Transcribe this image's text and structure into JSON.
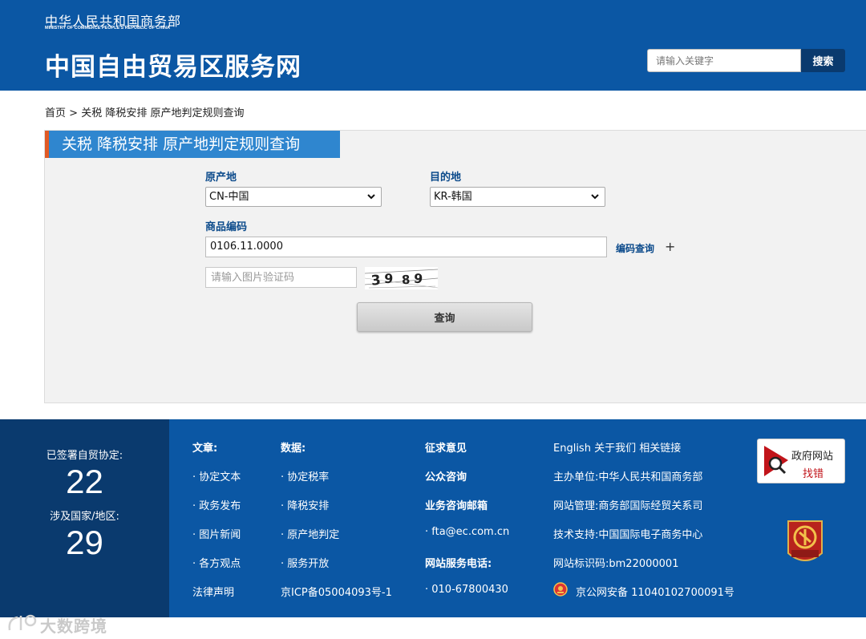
{
  "header": {
    "ministry_cn": "中华人民共和国商务部",
    "ministry_en": "MINISTRY OF COMMERCE PEOPLE'S REPUBLIC OF CHINA",
    "site_title": "中国自由贸易区服务网",
    "search_placeholder": "请输入关键字",
    "search_button": "搜索"
  },
  "breadcrumb": {
    "home": "首页",
    "separator": ">",
    "path": "关税 降税安排 原产地判定规则查询"
  },
  "query": {
    "title": "关税 降税安排 原产地判定规则查询",
    "origin_label": "原产地",
    "origin_value": "CN-中国",
    "destination_label": "目的地",
    "destination_value": "KR-韩国",
    "code_label": "商品编码",
    "code_value": "0106.11.0000",
    "code_lookup": "编码查询",
    "plus": "+",
    "captcha_placeholder": "请输入图片验证码",
    "captcha_text": "3989",
    "submit": "查询"
  },
  "footer": {
    "stats": {
      "signed_label": "已签署自贸协定:",
      "signed_value": "22",
      "countries_label": "涉及国家/地区:",
      "countries_value": "29"
    },
    "col1": {
      "heading": "文章:",
      "items": [
        "· 协定文本",
        "· 政务发布",
        "· 图片新闻",
        "· 各方观点"
      ],
      "bottom": "法律声明"
    },
    "col2": {
      "heading": "数据:",
      "items": [
        "· 协定税率",
        "· 降税安排",
        "· 原产地判定",
        "· 服务开放"
      ],
      "bottom": "京ICP备05004093号-1"
    },
    "col3": {
      "heading": "征求意见",
      "consult": "公众咨询",
      "email_heading": "业务咨询邮箱",
      "email": "· fta@ec.com.cn",
      "phone_heading": "网站服务电话:",
      "phone": "· 010-67800430"
    },
    "col4": {
      "links": "English 关于我们 相关链接",
      "sponsor": "主办单位:中华人民共和国商务部",
      "manager": "网站管理:商务部国际经贸关系司",
      "support": "技术支持:中国国际电子商务中心",
      "site_id": "网站标识码:bm22000001",
      "police": "京公网安备 11040102700091号"
    },
    "gov_badge": {
      "line1": "政府网站",
      "line2": "找错"
    }
  },
  "watermark": "大数跨境",
  "colors": {
    "brand_blue": "#0b57a4",
    "dark_blue": "#0a3a6e",
    "title_blue": "#2f86cf",
    "accent_orange": "#e15a25"
  }
}
